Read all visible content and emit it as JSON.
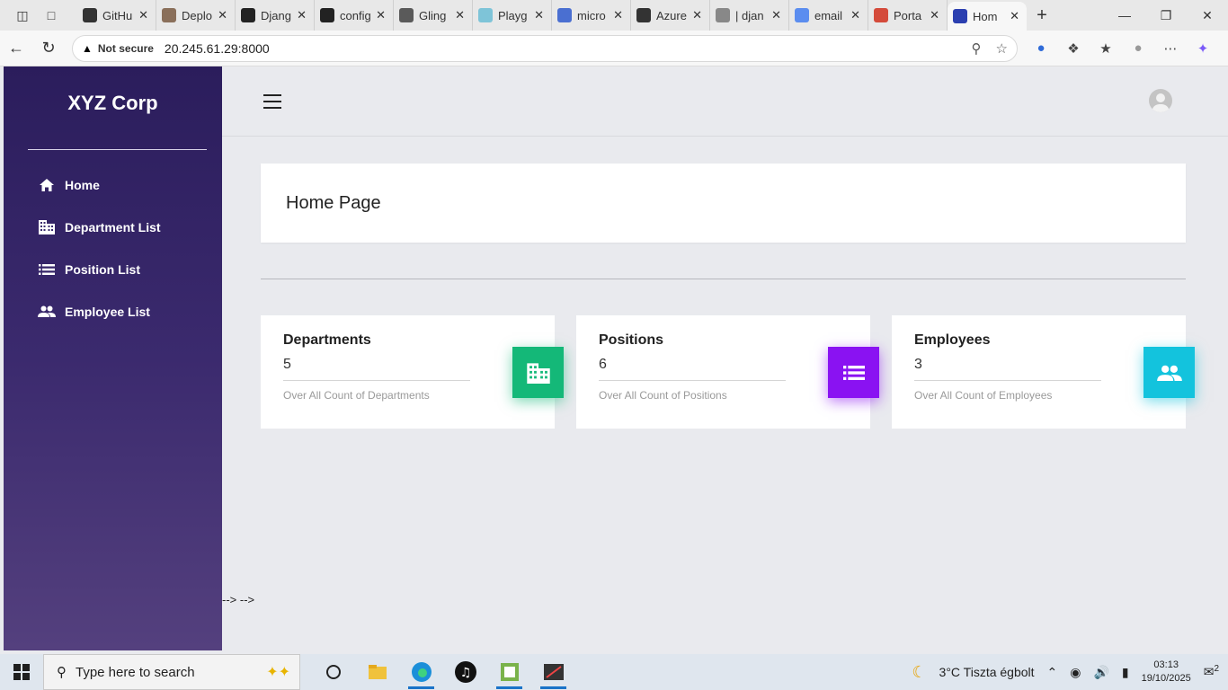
{
  "browser": {
    "tabs": [
      {
        "label": "GitHub",
        "fav_color": "#333333"
      },
      {
        "label": "Deploy",
        "fav_color": "#8a6f5a"
      },
      {
        "label": "Django",
        "fav_color": "#222222"
      },
      {
        "label": "config",
        "fav_color": "#222222"
      },
      {
        "label": "Gling",
        "fav_color": "#5a5a5a"
      },
      {
        "label": "Playg",
        "fav_color": "#7ec4d8"
      },
      {
        "label": "micro",
        "fav_color": "#4a6fd1"
      },
      {
        "label": "Azure",
        "fav_color": "#333333"
      },
      {
        "label": "| djan",
        "fav_color": "#888888"
      },
      {
        "label": "email",
        "fav_color": "#5b8def"
      },
      {
        "label": "Porta",
        "fav_color": "#d44a3a"
      },
      {
        "label": "Hom",
        "fav_color": "#2b3fb0"
      }
    ],
    "new_tab_label": "+",
    "security_label": "Not secure",
    "url": "20.245.61.29:8000"
  },
  "sidebar": {
    "brand": "XYZ Corp",
    "items": [
      {
        "label": "Home",
        "icon": "home-icon"
      },
      {
        "label": "Department List",
        "icon": "building-icon"
      },
      {
        "label": "Position List",
        "icon": "list-icon"
      },
      {
        "label": "Employee List",
        "icon": "people-icon"
      }
    ]
  },
  "main": {
    "page_title": "Home Page",
    "stats": [
      {
        "title": "Departments",
        "count": "5",
        "subtitle": "Over All Count of Departments",
        "color": "#14b878",
        "icon": "building-icon"
      },
      {
        "title": "Positions",
        "count": "6",
        "subtitle": "Over All Count of Positions",
        "color": "#8a12f2",
        "icon": "list-icon"
      },
      {
        "title": "Employees",
        "count": "3",
        "subtitle": "Over All Count of Employees",
        "color": "#13c3dd",
        "icon": "people-icon"
      }
    ],
    "stray_text": "--> -->"
  },
  "taskbar": {
    "search_placeholder": "Type here to search",
    "weather": "3°C  Tiszta égbolt",
    "time": "03:13",
    "date": "19/10/2025",
    "notifications": "2"
  }
}
